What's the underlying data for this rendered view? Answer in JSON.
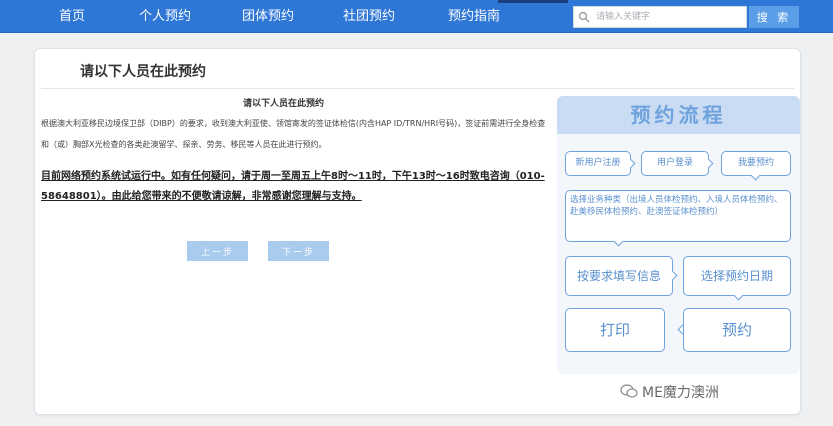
{
  "nav": {
    "items": [
      "首页",
      "个人预约",
      "团体预约",
      "社团预约",
      "预约指南"
    ],
    "search_placeholder": "请输入关键字",
    "search_button": "搜 索"
  },
  "card": {
    "title": "请以下人员在此预约",
    "heading": "请以下人员在此预约",
    "body": "根据澳大利亚移民边境保卫部（DIBP）的要求，收到澳大利亚使、领馆寄发的签证体检信(内含HAP ID/TRN/HRI号码)，签证前需进行全身检查和（或）胸部X光检查的各类赴澳留学、探亲、劳务、移民等人员在此进行预约。",
    "notice": "目前网络预约系统试运行中。如有任何疑问，请于周一至周五上午8时～11时，下午13时～16时致电咨询（010-58648801）。由此给您带来的不便敬请谅解，非常感谢您理解与支持。",
    "prev_button": "上一步",
    "next_button": "下一步"
  },
  "flow": {
    "title": "预约流程",
    "steps": [
      "新用户注册",
      "用户登录",
      "我要预约",
      "选择业务种类（出境人员体检预约、入境人员体检预约、赴美移民体检预约、赴澳签证体检预约）",
      "按要求填写信息",
      "选择预约日期",
      "打印",
      "预约"
    ]
  },
  "watermark": "ME魔力澳洲",
  "colors": {
    "nav_bg": "#2f77d6",
    "accent": "#6fa3de",
    "button_bg": "#a9cbee"
  }
}
